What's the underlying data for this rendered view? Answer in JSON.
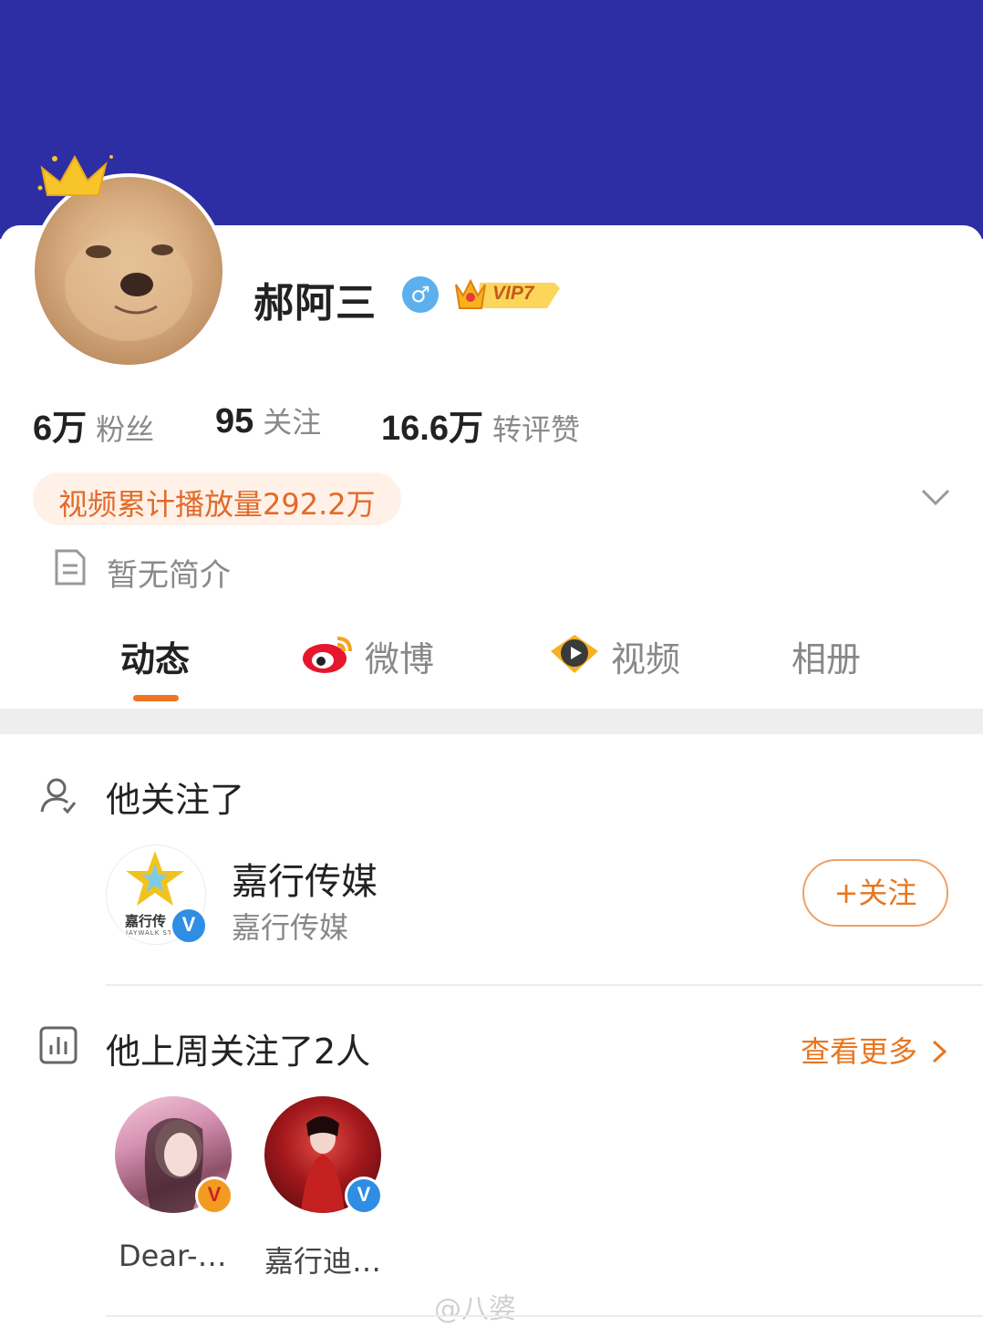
{
  "profile": {
    "username": "郝阿三",
    "gender_symbol": "♂",
    "vip_label": "VIP7",
    "stats": [
      {
        "value": "6万",
        "label": "粉丝"
      },
      {
        "value": "95",
        "label": "关注"
      },
      {
        "value": "16.6万",
        "label": "转评赞"
      }
    ],
    "video_play_count": "视频累计播放量292.2万",
    "bio": "暂无简介",
    "banner_color": "#2d2ea3",
    "accent_color": "#f0731f"
  },
  "tabs": [
    {
      "label": "动态",
      "active": true
    },
    {
      "label": "微博",
      "icon": "weibo-icon"
    },
    {
      "label": "视频",
      "icon": "video-icon"
    },
    {
      "label": "相册"
    }
  ],
  "following_section": {
    "title": "他关注了",
    "account": {
      "name": "嘉行传媒",
      "subtitle": "嘉行传媒",
      "logo_text": "嘉行传",
      "logo_sub": "JAYWALK ST",
      "verified_badge": "V"
    },
    "follow_button": "+关注"
  },
  "weekly_section": {
    "title": "他上周关注了2人",
    "see_more": "查看更多",
    "people": [
      {
        "name": "Dear-…",
        "badge": "V",
        "badge_color": "orange"
      },
      {
        "name": "嘉行迪…",
        "badge": "V",
        "badge_color": "blue"
      }
    ]
  },
  "watermark": "@八婆"
}
